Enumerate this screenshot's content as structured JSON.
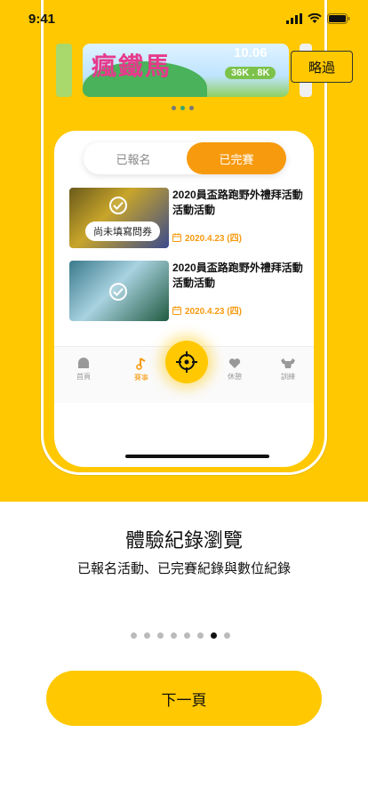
{
  "status_bar": {
    "time": "9:41"
  },
  "skip_label": "略過",
  "banner": {
    "title": "瘋鐵馬",
    "date": "10.06",
    "distances": "36K . 8K"
  },
  "segmented": {
    "registered_label": "已報名",
    "completed_label": "已完賽",
    "selected": "已完賽"
  },
  "events": [
    {
      "title": "2020員盃路跑野外禮拜活動活動活動",
      "date": "2020.4.23 (四)",
      "badge": "尚未填寫問券"
    },
    {
      "title": "2020員盃路跑野外禮拜活動活動活動",
      "date": "2020.4.23 (四)"
    }
  ],
  "tab_bar": [
    {
      "label": "首頁",
      "icon": "home-icon"
    },
    {
      "label": "賽事",
      "icon": "music-note-icon",
      "active": true
    },
    {
      "label": "休憩",
      "icon": "heart-icon"
    },
    {
      "label": "訓練",
      "icon": "dumbbell-icon"
    }
  ],
  "fab_icon": "crosshair-icon",
  "onboarding": {
    "title": "體驗紀錄瀏覽",
    "subtitle": "已報名活動、已完賽紀錄與數位紀錄",
    "total_pages": 8,
    "current_page": 7
  },
  "next_label": "下一頁",
  "colors": {
    "brand_yellow": "#FFC800",
    "accent_orange": "#F79A0E"
  }
}
